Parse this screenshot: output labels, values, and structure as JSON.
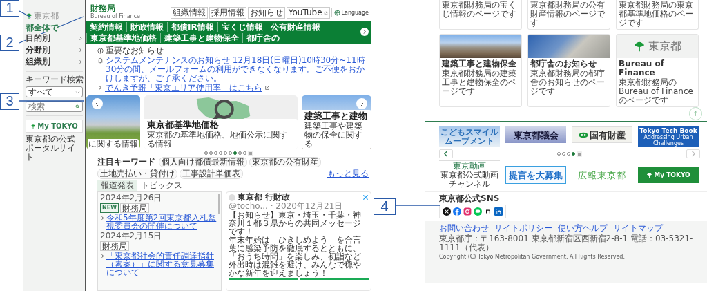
{
  "callouts": [
    {
      "number": "1"
    },
    {
      "number": "2"
    },
    {
      "number": "3"
    },
    {
      "number": "4"
    }
  ],
  "left_page": {
    "sidebar": {
      "logo": "東京都",
      "portal_link": "都全体で",
      "menu": [
        {
          "label": "目的別"
        },
        {
          "label": "分野別"
        },
        {
          "label": "組織別"
        }
      ],
      "keyword_label": "キーワード検索",
      "scope": "すべて",
      "search": {
        "placeholder": "検索"
      },
      "banner": "My TOKYO",
      "banner_caption": "東京都の公式ポータルサイト"
    },
    "header": {
      "title": "財務局",
      "subtitle": "Bureau of Finance",
      "links": [
        {
          "label": "組織情報",
          "external": false
        },
        {
          "label": "採用情報",
          "external": false
        },
        {
          "label": "お知らせ",
          "external": false
        },
        {
          "label": "YouTube",
          "external": true
        }
      ],
      "language": "Language"
    },
    "nav": [
      "契約情報",
      "財政情報",
      "都債IR情報",
      "宝くじ情報",
      "公有財産情報",
      "東京都基準地価格",
      "建築工事と建物保全",
      "都庁舎の"
    ],
    "notices": {
      "heading": "重要なお知らせ",
      "items": [
        {
          "kind": "alert",
          "text": "システムメンテナンスのお知らせ 12月18日(日曜日)10時30分~11時30分の間、メールフォームの利用ができなくなります。ご不便をおかけしますが、ご了承ください。",
          "external": false
        },
        {
          "kind": "link",
          "text": "でんき予報「東京エリア使用率」はこちら",
          "external": true
        }
      ]
    },
    "carousel": {
      "slides": [
        {
          "kind": "photo",
          "caption": "に関する情報"
        },
        {
          "kind": "map",
          "title": "東京都基準地価格",
          "caption": "東京都の基準地価格、地価公示に関する情報"
        },
        {
          "kind": "construction",
          "title": "建築工事と建物",
          "caption": "建築工事や建築物の保全に関する"
        }
      ],
      "dots": [
        {
          "selected": false
        },
        {
          "selected": false
        },
        {
          "selected": false
        },
        {
          "selected": false
        },
        {
          "selected": false
        },
        {
          "selected": false
        },
        {
          "selected": true
        },
        {
          "selected": false
        },
        {
          "selected": false
        }
      ]
    },
    "keywords": {
      "heading": "注目キーワード",
      "chips": [
        "個人向け都債最新情報",
        "東京都の公有財産",
        "土地売払い・貸付け",
        "工事設計単価表"
      ],
      "more": "もっと見る"
    },
    "news": {
      "tabs": [
        {
          "label": "報道発表",
          "selected": true
        },
        {
          "label": "トピックス",
          "selected": false
        }
      ],
      "items": [
        {
          "date": "2024年2月26日",
          "new_badge": "NEW",
          "tag": "財務局",
          "title": "令和5年度第2回東京都入札監視委員会の開催について"
        },
        {
          "date": "2024年2月15日",
          "tag": "財務局",
          "title": "「東京都社会的責任調達指針（素案）」に関する意見募集について"
        }
      ]
    },
    "twitter": {
      "account": "東京都 行財政",
      "meta": "@tocho... · 2020年12月21日",
      "paragraphs": [
        "【お知らせ】東京・埼玉・千葉・神奈川１都３県からの共同メッセージです！",
        "年末年始は「ひきしめよう」を合言葉に感染予防を徹底するとともに、「おうち時間」を楽しみ、初詣など外出時は混雑を避け、みんなで穏やかな新年を迎えましょう！"
      ]
    }
  },
  "right_page": {
    "cards_top": [
      {
        "description": "東京都財務局の宝くじ情報のページです"
      },
      {
        "description": "東京都財務局の公有財産情報のページです"
      },
      {
        "description": "東京都財務局の東京都基準地価格のページです"
      }
    ],
    "cards": [
      {
        "kind": "construction",
        "title": "建築工事と建物保全",
        "description": "東京都財務局の建築工事と建物保全のページです"
      },
      {
        "kind": "building",
        "title": "都庁舎のお知らせ",
        "description": "東京都財務局の都庁舎のお知らせのページです"
      },
      {
        "kind": "logo",
        "logo_text": "東京都",
        "title": "Bureau of Finance",
        "description": "東京都財務局のBureau of Financeのページです"
      }
    ],
    "banners": [
      {
        "kind": "kodomo",
        "text": "こどもスマイルムーブメント"
      },
      {
        "kind": "gikai",
        "text": "東京都議会"
      },
      {
        "kind": "kokuyu",
        "text": "国有財産"
      },
      {
        "kind": "techbook",
        "text": "Tokyo Tech Book",
        "subtext": "Addressing Urban Challenges"
      }
    ],
    "banner_dots": [
      {
        "selected": false
      },
      {
        "selected": false
      },
      {
        "selected": false
      },
      {
        "selected": true
      }
    ],
    "banners_2": [
      {
        "kind": "douga",
        "text": "東京動画",
        "subtext": "東京都公式動画チャンネル"
      },
      {
        "kind": "teigen",
        "text": "提言を大募集"
      },
      {
        "kind": "koho",
        "text": "広報東京都"
      },
      {
        "kind": "mytokyo",
        "text": "My TOKYO"
      }
    ],
    "sns": {
      "heading": "東京都公式SNS",
      "icons": [
        {
          "kind": "x"
        },
        {
          "kind": "facebook"
        },
        {
          "kind": "instagram"
        },
        {
          "kind": "line"
        },
        {
          "kind": "note"
        },
        {
          "kind": "linkedin"
        }
      ]
    },
    "footer": {
      "links": [
        "お問い合わせ",
        "サイトポリシー",
        "使い方ヘルプ",
        "サイトマップ"
      ],
      "address": "東京都庁：〒163-8001 東京都新宿区西新宿2-8-1 電話：03-5321-1111（代表）",
      "copyright": "Copyright (C) Tokyo Metropolitan Government. All Rights Reserved."
    }
  }
}
